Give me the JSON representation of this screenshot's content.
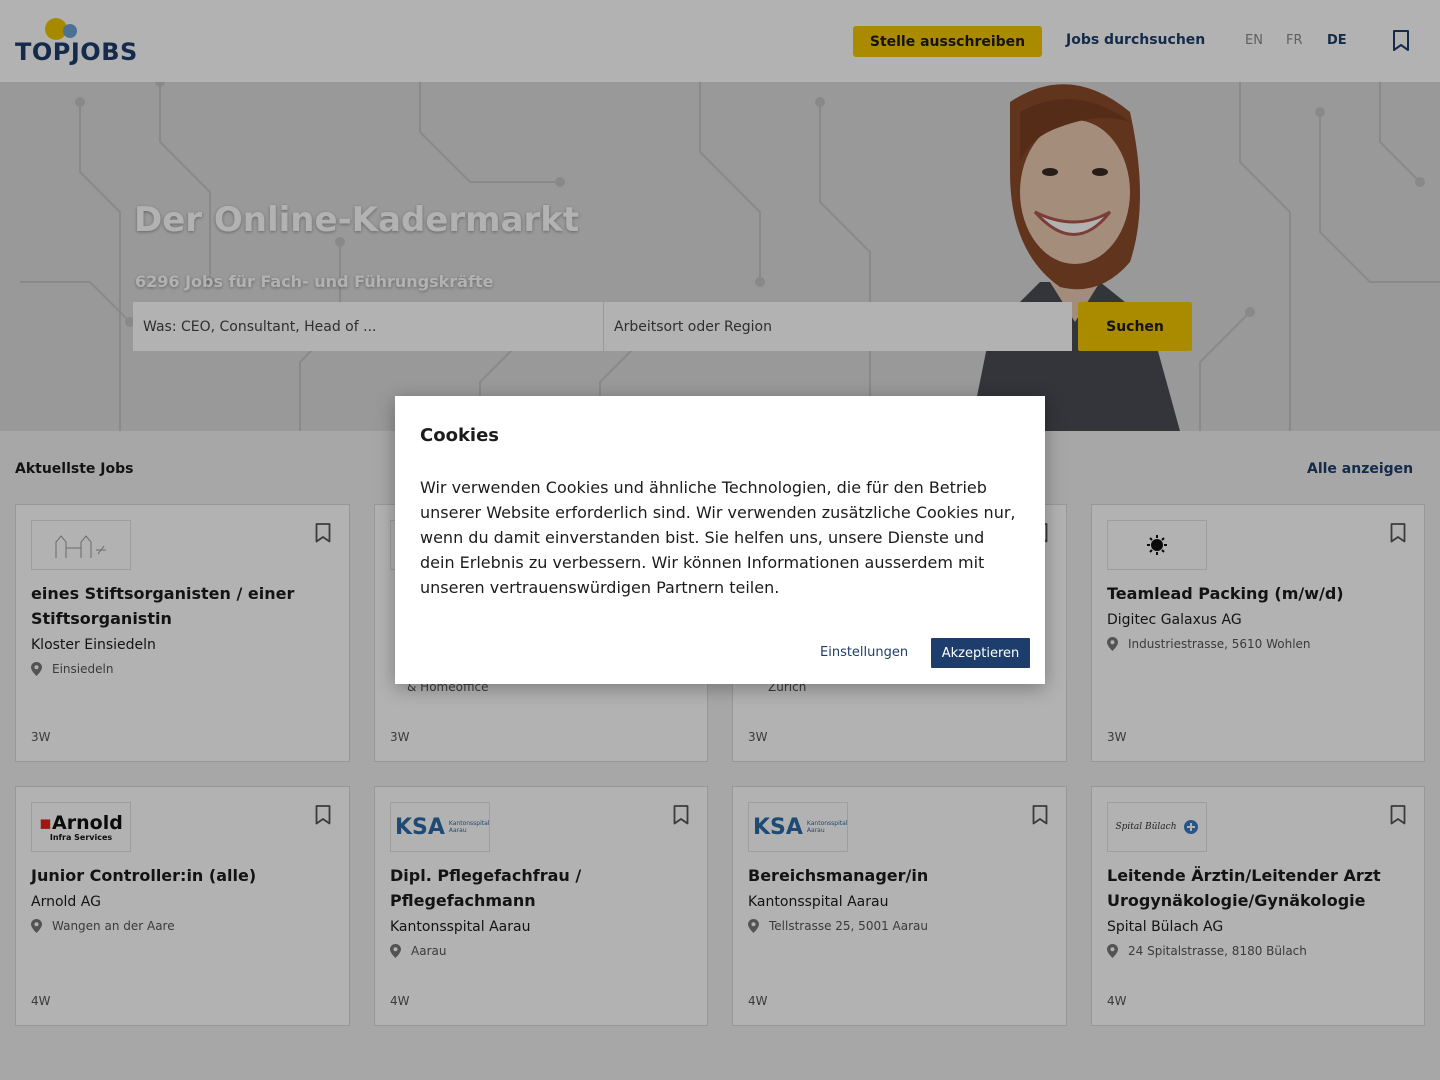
{
  "header": {
    "logo_text": "TOPJOBS",
    "post_job_label": "Stelle ausschreiben",
    "browse_jobs_label": "Jobs durchsuchen",
    "languages": [
      "EN",
      "FR",
      "DE"
    ],
    "active_language": "DE"
  },
  "hero": {
    "title": "Der Online-Kadermarkt",
    "subtitle": "6296 Jobs für Fach- und Führungskräfte",
    "what_placeholder": "Was: CEO, Consultant, Head of ...",
    "where_placeholder": "Arbeitsort oder Region",
    "search_label": "Suchen"
  },
  "jobs": {
    "section_title": "Aktuellste Jobs",
    "show_all_label": "Alle anzeigen",
    "cards": [
      {
        "title": "eines Stiftsorganisten / einer Stiftsorganistin",
        "company": "Kloster Einsiedeln",
        "location": "Einsiedeln",
        "age": "3W",
        "logo": "kloster-logo"
      },
      {
        "title": "",
        "company": "",
        "location": "& Homeoffice",
        "age": "3W",
        "logo": ""
      },
      {
        "title": "",
        "company": "",
        "location": "Zürich",
        "age": "3W",
        "logo": ""
      },
      {
        "title": "Teamlead Packing (m/w/d)",
        "company": "Digitec Galaxus AG",
        "location": "Industriestrasse, 5610 Wohlen",
        "age": "3W",
        "logo": "digitec-logo"
      },
      {
        "title": "Junior Controller:in (alle)",
        "company": "Arnold AG",
        "location": "Wangen an der Aare",
        "age": "4W",
        "logo": "arnold-logo",
        "logo_text": "Arnold",
        "logo_sub": "Infra Services"
      },
      {
        "title": "Dipl. Pflegefachfrau / Pflegefachmann",
        "company": "Kantonsspital Aarau",
        "location": "Aarau",
        "age": "4W",
        "logo": "ksa-logo",
        "logo_text": "KSA",
        "logo_sub": "Kantonsspital Aarau"
      },
      {
        "title": "Bereichsmanager/in",
        "company": "Kantonsspital Aarau",
        "location": "Tellstrasse 25, 5001 Aarau",
        "age": "4W",
        "logo": "ksa-logo",
        "logo_text": "KSA",
        "logo_sub": "Kantonsspital Aarau"
      },
      {
        "title": "Leitende Ärztin/Leitender Arzt Urogynäkologie/Gynäkologie",
        "company": "Spital Bülach AG",
        "location": "24 Spitalstrasse, 8180 Bülach",
        "age": "4W",
        "logo": "buelach-logo",
        "logo_text": "Spital Bülach"
      }
    ]
  },
  "cookie_modal": {
    "title": "Cookies",
    "text": "Wir verwenden Cookies und ähnliche Technologien, die für den Betrieb unserer Website erforderlich sind. Wir verwenden zusätzliche Cookies nur, wenn du damit einverstanden bist. Sie helfen uns, unsere Dienste und dein Erlebnis zu verbessern. Wir können Informationen ausserdem mit unseren vertrauenswürdigen Partnern teilen.",
    "settings_label": "Einstellungen",
    "accept_label": "Akzeptieren"
  },
  "colors": {
    "brand_navy": "#1d3e6c",
    "brand_yellow": "#f4c800",
    "logo_blue": "#6fa3d4"
  }
}
